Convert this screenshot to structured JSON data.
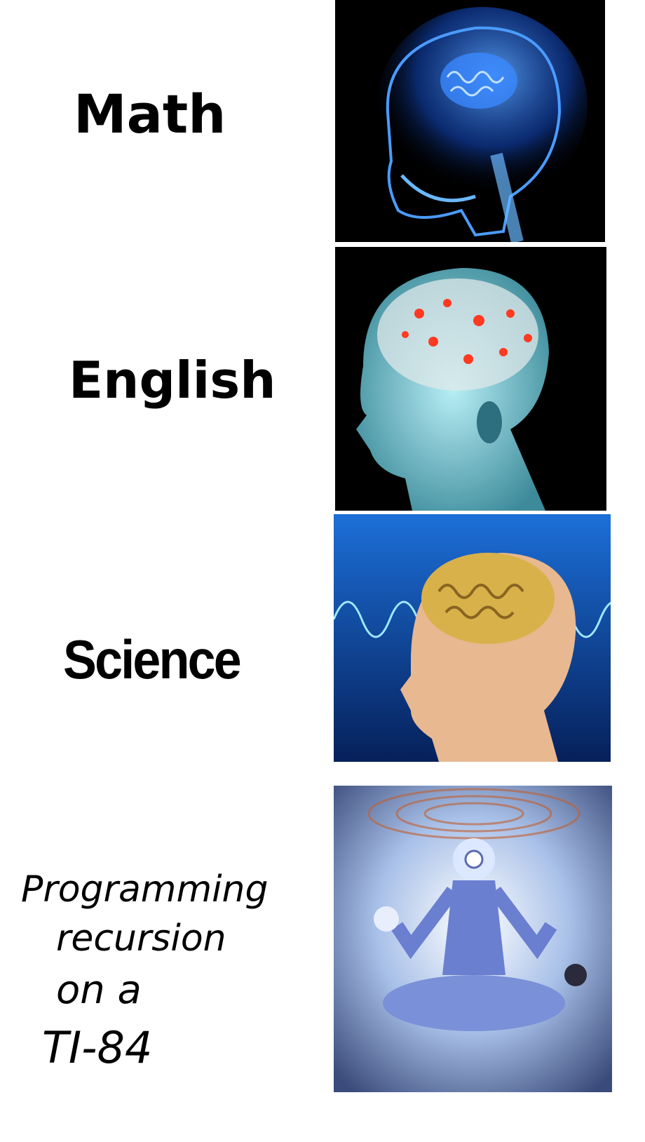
{
  "rows": [
    {
      "label": "Math",
      "image": "glowing-skull-brain"
    },
    {
      "label": "English",
      "image": "glowing-brain-head"
    },
    {
      "label": "Science",
      "image": "golden-brain-waves"
    },
    {
      "label": "Programming recursion on a TI-84",
      "image": "cosmic-meditating-figure",
      "handwritten": [
        "Programming",
        "recursion",
        "on a",
        "TI-84"
      ]
    }
  ],
  "colors": {
    "panel1_bg": "#000000",
    "panel1_glow": "#2a7fff",
    "panel2_bg": "#000000",
    "panel2_head": "#7fc9d6",
    "panel2_spark": "#ff3a20",
    "panel3_bg": "#0a3a8a",
    "panel3_brain": "#d9b14a",
    "panel3_skin": "#e8b890",
    "panel4_bg": "#c8d8e8",
    "panel4_figure": "#6a7fd0"
  }
}
